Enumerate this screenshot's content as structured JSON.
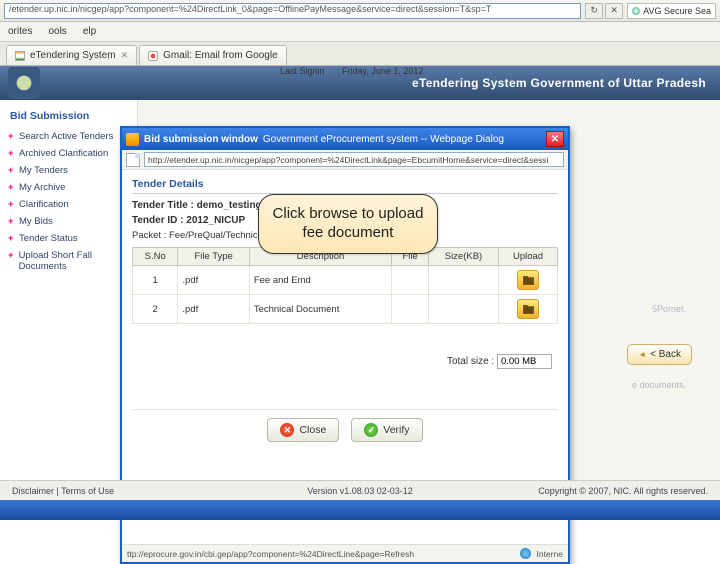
{
  "browser": {
    "address": "/etender.up.nic.in/nicgep/app?component=%24DirectLink_0&page=OfflinePayMessage&service=direct&session=T&sp=T",
    "avg_label": "AVG Secure Sea",
    "menu": {
      "favorites": "orites",
      "tools": "ools",
      "help": "elp"
    },
    "tabs": [
      {
        "label": "eTendering System",
        "fav": "fav-in"
      },
      {
        "label": "Gmail: Email from Google",
        "fav": "fav-gm"
      }
    ]
  },
  "banner": {
    "last_signin_label": "Last Signin",
    "last_signin_value": ": Friday, June 1, 2012",
    "title": "eTendering System Government of Uttar Pradesh"
  },
  "sidebar": {
    "heading": "Bid Submission",
    "items": [
      {
        "label": "Search Active Tenders"
      },
      {
        "label": "Archived Clarification"
      },
      {
        "label": "My Tenders"
      },
      {
        "label": "My Archive"
      },
      {
        "label": "Clarification"
      },
      {
        "label": "My Bids"
      },
      {
        "label": "Tender Status"
      },
      {
        "label": "Upload Short Fall Documents"
      }
    ]
  },
  "bg": {
    "ghost_a": "5Pornet.",
    "ghost_b": "e documents.",
    "back_label": "< Back"
  },
  "dialog": {
    "title_a": "Bid submission window",
    "title_b": "Government eProcurement system -- Webpage Dialog",
    "url": "http://etender.up.nic.in/nicgep/app?component=%24DirectLink&page=EbcumitHome&service=direct&sessi",
    "tender_details_head": "Tender Details",
    "tender_title_label": "Tender Title :",
    "tender_title_value": "demo_testing",
    "tender_id_label": "Tender ID :",
    "tender_id_value": "2012_NICUP",
    "packet_label": "Packet : Fee/PreQual/Technical",
    "columns": {
      "sno": "S.No",
      "ftype": "File Type",
      "desc": "Description",
      "file": "File",
      "size": "Size(KB)",
      "upload": "Upload"
    },
    "rows": [
      {
        "sno": "1",
        "ftype": ".pdf",
        "desc": "Fee and Emd",
        "file": "",
        "size": ""
      },
      {
        "sno": "2",
        "ftype": ".pdf",
        "desc": "Technical Document",
        "file": "",
        "size": ""
      }
    ],
    "total_size_label": "Total size :",
    "total_size_value": "0.00 MB",
    "close_label": "Close",
    "verify_label": "Verify",
    "status_url": "ttp://eprocure.gov.in/cbi.gep/app?component=%24DirectLine&page=Refresh",
    "status_net": "Interne"
  },
  "callout": {
    "text": "Click browse to upload fee document"
  },
  "footer": {
    "left": "Disclaimer   |   Terms of Use",
    "mid": "Version v1.08.03  02-03-12",
    "right": "Copyright © 2007, NIC. All rights reserved."
  }
}
